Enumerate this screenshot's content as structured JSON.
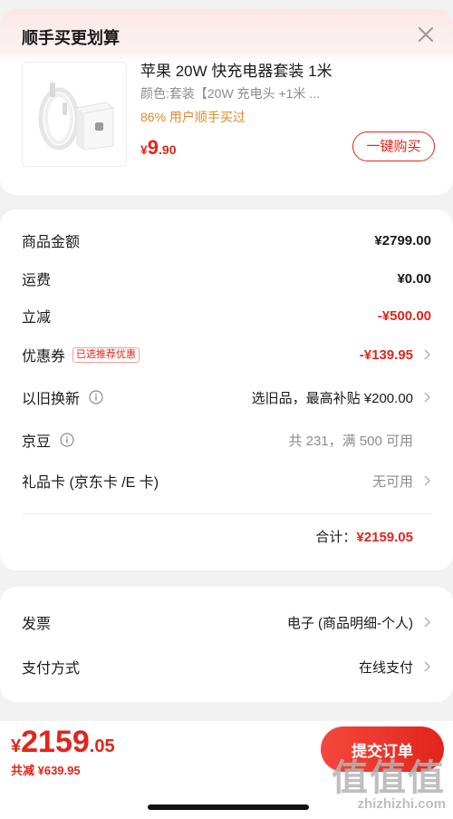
{
  "popup": {
    "title": "顺手买更划算",
    "close_icon": "close-icon"
  },
  "product": {
    "name": "苹果 20W 快充电器套装 1米",
    "variant": "颜色:套装【20W 充电头 +1米 ...",
    "social": "86% 用户顺手买过",
    "price_symbol": "¥",
    "price_int": "9",
    "price_dec": ".90",
    "buy_button": "一键购买"
  },
  "summary": {
    "goods_amount": {
      "label": "商品金额",
      "value": "¥2799.00"
    },
    "shipping": {
      "label": "运费",
      "value": "¥0.00"
    },
    "instant_discount": {
      "label": "立减",
      "value": "-¥500.00"
    },
    "coupon": {
      "label": "优惠券",
      "badge": "已选推荐优惠",
      "value": "-¥139.95"
    },
    "trade_in": {
      "label": "以旧换新",
      "value": "选旧品，最高补贴 ¥200.00"
    },
    "jingdou": {
      "label": "京豆",
      "value": "共 231，满 500 可用"
    },
    "gift_card": {
      "label": "礼品卡 (京东卡 /E 卡)",
      "value": "无可用"
    },
    "total_label": "合计：",
    "total_value": "¥2159.05"
  },
  "invoice": {
    "invoice": {
      "label": "发票",
      "value": "电子 (商品明细-个人)"
    },
    "payment": {
      "label": "支付方式",
      "value": "在线支付"
    }
  },
  "bottom": {
    "price_symbol": "¥",
    "price_int": "2159",
    "price_dec": ".05",
    "saved": "共减 ¥639.95",
    "submit_button": "提交订单"
  },
  "watermark": {
    "logo": "值值值",
    "url": "zhizhizhi.com"
  },
  "colors": {
    "accent": "#e1251b",
    "social": "#d98a2b",
    "muted": "#8c8c8c"
  }
}
